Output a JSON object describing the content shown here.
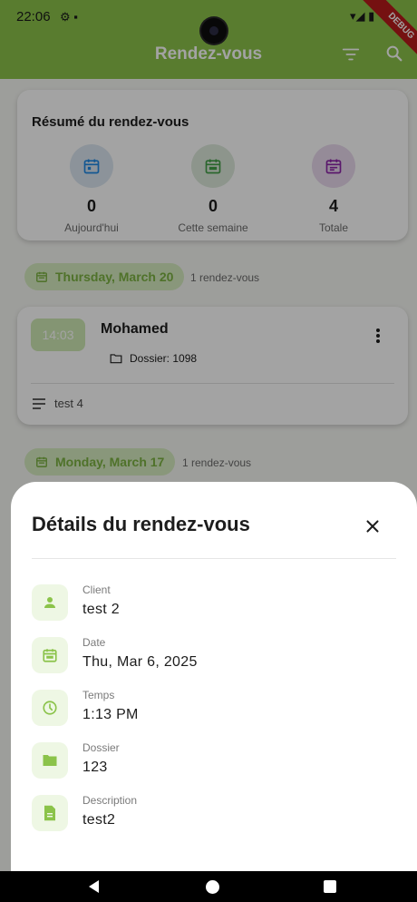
{
  "status_bar": {
    "time": "22:06"
  },
  "app_bar": {
    "title": "Rendez-vous",
    "debug_label": "DEBUG"
  },
  "summary": {
    "title": "Résumé du rendez-vous",
    "stats": [
      {
        "value": "0",
        "label": "Aujourd'hui",
        "icon": "calendar-icon",
        "color": "#1e88e5",
        "bg": "#dbe7f1"
      },
      {
        "value": "0",
        "label": "Cette semaine",
        "icon": "calendar-week-icon",
        "color": "#43a047",
        "bg": "#dde9dc"
      },
      {
        "value": "4",
        "label": "Totale",
        "icon": "calendar-total-icon",
        "color": "#8e24aa",
        "bg": "#ead9ee"
      }
    ]
  },
  "groups": [
    {
      "date": "Thursday, March 20",
      "count": "1 rendez-vous",
      "appointment": {
        "time": "14:03",
        "name": "Mohamed",
        "folder": "Dossier: 1098",
        "note": "test 4"
      }
    },
    {
      "date": "Monday, March 17",
      "count": "1 rendez-vous"
    }
  ],
  "sheet": {
    "title": "Détails du rendez-vous",
    "rows": [
      {
        "label": "Client",
        "value": "test 2",
        "icon": "person-icon"
      },
      {
        "label": "Date",
        "value": "Thu, Mar 6, 2025",
        "icon": "calendar-icon"
      },
      {
        "label": "Temps",
        "value": "1:13 PM",
        "icon": "clock-icon"
      },
      {
        "label": "Dossier",
        "value": "123",
        "icon": "folder-icon"
      },
      {
        "label": "Description",
        "value": "test2",
        "icon": "document-icon"
      }
    ]
  },
  "colors": {
    "accent": "#8bc34a",
    "accent_dark": "#7cb342"
  }
}
